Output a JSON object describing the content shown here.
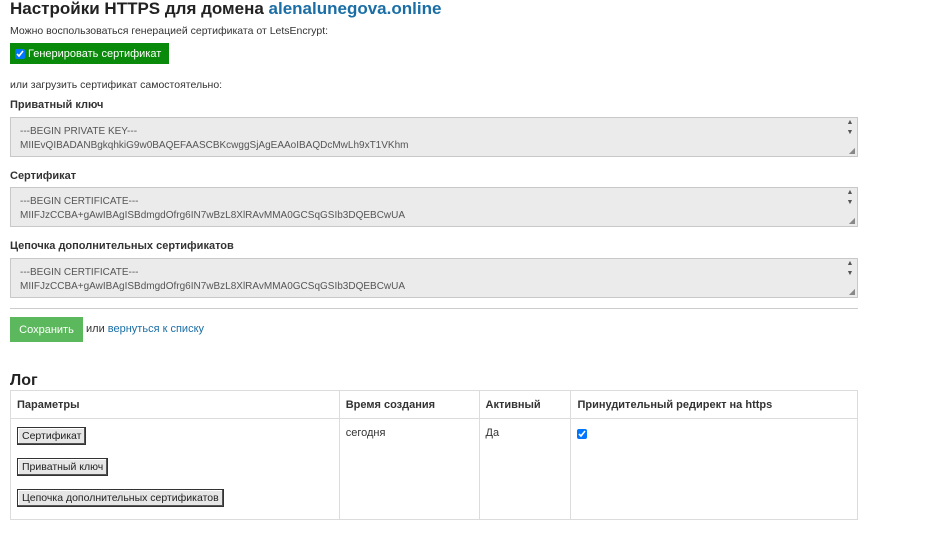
{
  "header": {
    "title_prefix": "Настройки HTTPS для домена",
    "domain": "alenalunegova.online"
  },
  "letsencrypt": {
    "hint": "Можно воспользоваться генерацией сертификата от LetsEncrypt:",
    "generate_label": "Генерировать сертификат",
    "generate_checked": true
  },
  "manual": {
    "hint": "или загрузить сертификат самостоятельно:",
    "private_key": {
      "label": "Приватный ключ",
      "value": "---BEGIN PRIVATE KEY---\nMIIEvQIBADANBgkqhkiG9w0BAQEFAASCBKcwggSjAgEAAoIBAQDcMwLh9xT1VKhm"
    },
    "certificate": {
      "label": "Сертификат",
      "value": "---BEGIN CERTIFICATE---\nMIIFJzCCBA+gAwIBAgISBdmgdOfrg6IN7wBzL8XlRAvMMA0GCSqGSIb3DQEBCwUA"
    },
    "chain": {
      "label": "Цепочка дополнительных сертификатов",
      "value": "---BEGIN CERTIFICATE---\nMIIFJzCCBA+gAwIBAgISBdmgdOfrg6IN7wBzL8XlRAvMMA0GCSqGSIb3DQEBCwUA"
    }
  },
  "actions": {
    "save_label": "Сохранить",
    "or_text": "или",
    "back_link": "вернуться к списку"
  },
  "log": {
    "title": "Лог",
    "columns": [
      "Параметры",
      "Время создания",
      "Активный",
      "Принудительный редирект на https"
    ],
    "rows": [
      {
        "buttons": [
          "Сертификат",
          "Приватный ключ",
          "Цепочка дополнительных сертификатов"
        ],
        "created": "сегодня",
        "active": "Да",
        "redirect_checked": true
      }
    ]
  },
  "colors": {
    "link": "#1a6ea5",
    "generate_bg": "#0a8a0a",
    "save_bg": "#5cb85c"
  }
}
